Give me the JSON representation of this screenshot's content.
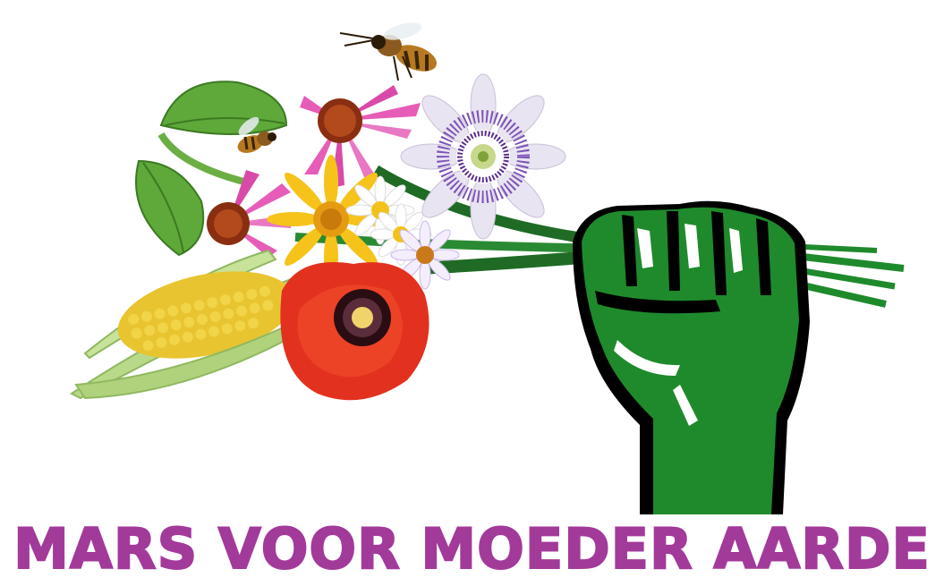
{
  "title": "MARS VOOR MOEDER AARDE",
  "colors": {
    "background": "#ffffff",
    "title": "#a23a9a",
    "fist_green": "#1f8a2c",
    "fist_shadow": "#000000",
    "stem_green": "#2e7d32",
    "leaf_green": "#5fa83a",
    "corn_yellow": "#e8c430",
    "husk_green": "#b9d98a",
    "poppy_red": "#e3311f",
    "echinacea_pink": "#e65db8",
    "sunflower_yellow": "#f6c31a",
    "passionflower_purple": "#7e55b8",
    "daisy_white": "#ffffff",
    "bee_brown": "#8a5a1e"
  },
  "illustration": {
    "icons": [
      "raised-fist-icon",
      "bee-icon",
      "corn-icon",
      "poppy-icon",
      "echinacea-icon",
      "sunflower-icon",
      "passionflower-icon",
      "daisy-icon",
      "leaf-icon"
    ]
  }
}
